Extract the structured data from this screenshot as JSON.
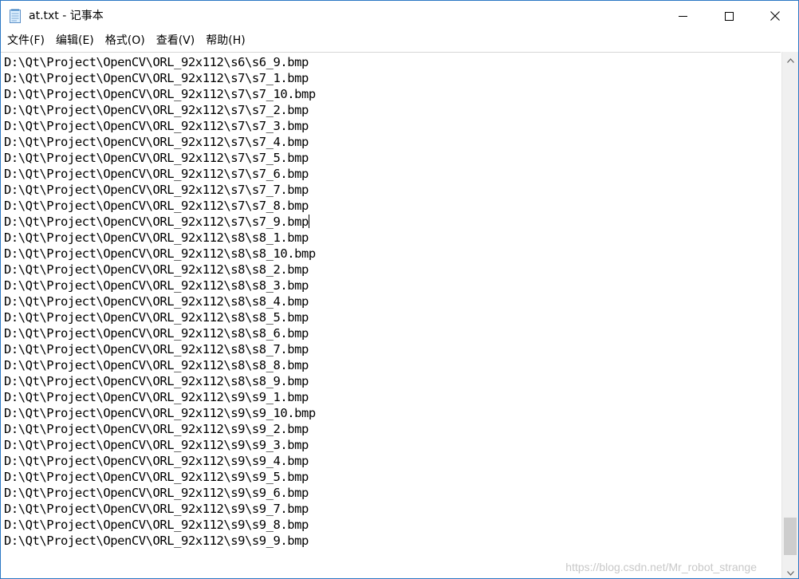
{
  "window": {
    "title": "at.txt - 记事本",
    "app_icon": "notepad-icon",
    "controls": {
      "minimize_icon": "minimize-icon",
      "maximize_icon": "maximize-icon",
      "close_icon": "close-icon"
    }
  },
  "menubar": {
    "items": [
      {
        "label": "文件(F)"
      },
      {
        "label": "编辑(E)"
      },
      {
        "label": "格式(O)"
      },
      {
        "label": "查看(V)"
      },
      {
        "label": "帮助(H)"
      }
    ]
  },
  "editor": {
    "lines": [
      "D:\\Qt\\Project\\OpenCV\\ORL_92x112\\s6\\s6_9.bmp",
      "D:\\Qt\\Project\\OpenCV\\ORL_92x112\\s7\\s7_1.bmp",
      "D:\\Qt\\Project\\OpenCV\\ORL_92x112\\s7\\s7_10.bmp",
      "D:\\Qt\\Project\\OpenCV\\ORL_92x112\\s7\\s7_2.bmp",
      "D:\\Qt\\Project\\OpenCV\\ORL_92x112\\s7\\s7_3.bmp",
      "D:\\Qt\\Project\\OpenCV\\ORL_92x112\\s7\\s7_4.bmp",
      "D:\\Qt\\Project\\OpenCV\\ORL_92x112\\s7\\s7_5.bmp",
      "D:\\Qt\\Project\\OpenCV\\ORL_92x112\\s7\\s7_6.bmp",
      "D:\\Qt\\Project\\OpenCV\\ORL_92x112\\s7\\s7_7.bmp",
      "D:\\Qt\\Project\\OpenCV\\ORL_92x112\\s7\\s7_8.bmp",
      "D:\\Qt\\Project\\OpenCV\\ORL_92x112\\s7\\s7_9.bmp",
      "D:\\Qt\\Project\\OpenCV\\ORL_92x112\\s8\\s8_1.bmp",
      "D:\\Qt\\Project\\OpenCV\\ORL_92x112\\s8\\s8_10.bmp",
      "D:\\Qt\\Project\\OpenCV\\ORL_92x112\\s8\\s8_2.bmp",
      "D:\\Qt\\Project\\OpenCV\\ORL_92x112\\s8\\s8_3.bmp",
      "D:\\Qt\\Project\\OpenCV\\ORL_92x112\\s8\\s8_4.bmp",
      "D:\\Qt\\Project\\OpenCV\\ORL_92x112\\s8\\s8_5.bmp",
      "D:\\Qt\\Project\\OpenCV\\ORL_92x112\\s8\\s8_6.bmp",
      "D:\\Qt\\Project\\OpenCV\\ORL_92x112\\s8\\s8_7.bmp",
      "D:\\Qt\\Project\\OpenCV\\ORL_92x112\\s8\\s8_8.bmp",
      "D:\\Qt\\Project\\OpenCV\\ORL_92x112\\s8\\s8_9.bmp",
      "D:\\Qt\\Project\\OpenCV\\ORL_92x112\\s9\\s9_1.bmp",
      "D:\\Qt\\Project\\OpenCV\\ORL_92x112\\s9\\s9_10.bmp",
      "D:\\Qt\\Project\\OpenCV\\ORL_92x112\\s9\\s9_2.bmp",
      "D:\\Qt\\Project\\OpenCV\\ORL_92x112\\s9\\s9_3.bmp",
      "D:\\Qt\\Project\\OpenCV\\ORL_92x112\\s9\\s9_4.bmp",
      "D:\\Qt\\Project\\OpenCV\\ORL_92x112\\s9\\s9_5.bmp",
      "D:\\Qt\\Project\\OpenCV\\ORL_92x112\\s9\\s9_6.bmp",
      "D:\\Qt\\Project\\OpenCV\\ORL_92x112\\s9\\s9_7.bmp",
      "D:\\Qt\\Project\\OpenCV\\ORL_92x112\\s9\\s9_8.bmp",
      "D:\\Qt\\Project\\OpenCV\\ORL_92x112\\s9\\s9_9.bmp"
    ],
    "caret_line_index": 10
  },
  "scrollbar": {
    "up_icon": "scroll-up-arrow-icon",
    "down_icon": "scroll-down-arrow-icon",
    "scroll_position": 0.98
  },
  "watermark": {
    "text": "https://blog.csdn.net/Mr_robot_strange"
  },
  "colors": {
    "window_border": "#2b78c4",
    "thumb": "#cdcdcd",
    "track": "#f0f0f0",
    "watermark": "#c8c8c8"
  }
}
